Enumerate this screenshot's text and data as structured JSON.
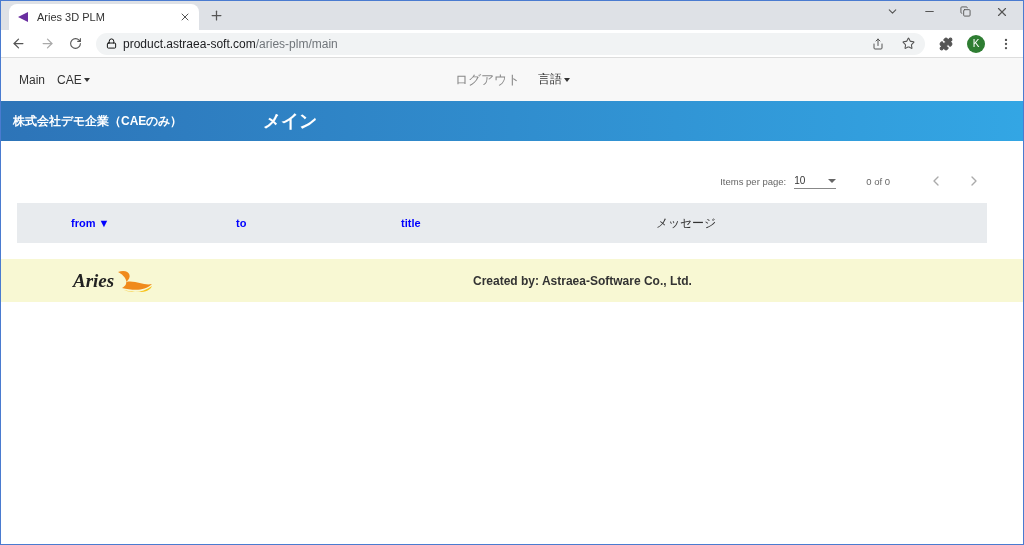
{
  "browser": {
    "tab": {
      "title": "Aries 3D PLM",
      "selected": true
    },
    "url_host": "product.astraea-soft.com",
    "url_path": "/aries-plm/main",
    "avatar": "K"
  },
  "navbar": {
    "left": [
      {
        "label": "Main",
        "dropdown": false
      },
      {
        "label": "CAE",
        "dropdown": true
      }
    ],
    "right": [
      {
        "label": "ログアウト",
        "dropdown": false,
        "muted": true
      },
      {
        "label": "言語",
        "dropdown": true,
        "muted": false
      }
    ]
  },
  "banner": {
    "company": "株式会社デモ企業（CAEのみ）",
    "title": "メイン"
  },
  "paginator": {
    "items_per_page_label": "Items per page:",
    "page_size": "10",
    "range": "0 of 0"
  },
  "table": {
    "columns": [
      {
        "label": "from ▼",
        "link": true
      },
      {
        "label": "to",
        "link": true
      },
      {
        "label": "title",
        "link": true
      },
      {
        "label": "メッセージ",
        "link": false
      }
    ]
  },
  "footer": {
    "logo_text": "Aries",
    "credit": "Created by: Astraea-Software Co., Ltd."
  }
}
